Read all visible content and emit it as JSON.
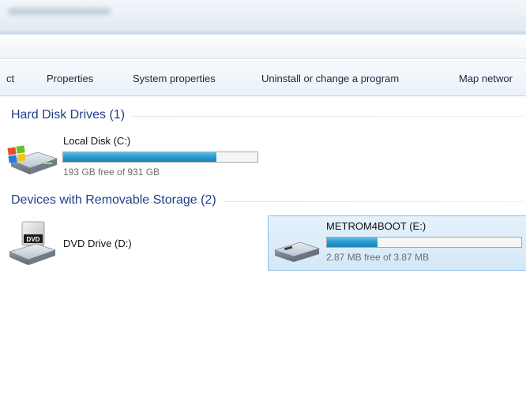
{
  "toolbar": {
    "items": [
      "ct",
      "Properties",
      "System properties",
      "Uninstall or change a program",
      "Map networ"
    ]
  },
  "groups": [
    {
      "title": "Hard Disk Drives (1)",
      "drives": [
        {
          "name": "Local Disk (C:)",
          "space": "193 GB free of 931 GB",
          "used_fraction": 0.79,
          "icon": "windows-hard-drive-icon"
        }
      ]
    },
    {
      "title": "Devices with Removable Storage (2)",
      "drives": [
        {
          "name": "DVD Drive (D:)",
          "icon": "dvd-drive-icon"
        },
        {
          "name": "METROM4BOOT (E:)",
          "space": "2.87 MB free of 3.87 MB",
          "used_fraction": 0.26,
          "icon": "usb-drive-icon",
          "selected": true
        }
      ]
    }
  ],
  "colors": {
    "group_header": "#1f3e8a",
    "bar_fill": "#2a9cd2",
    "selection": "#d4e8f8"
  }
}
